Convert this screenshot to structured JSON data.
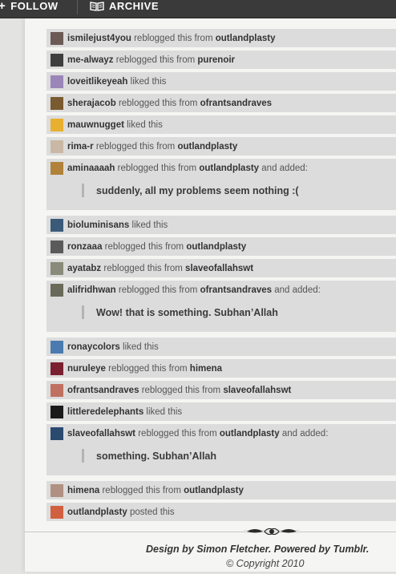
{
  "topbar": {
    "follow_label": "FOLLOW",
    "archive_label": "ARCHIVE"
  },
  "notes": [
    {
      "user": "ismilejust4you",
      "action": "reblogged this from",
      "source": "outlandplasty",
      "avatar_color": "#6b5a55"
    },
    {
      "user": "me-alwayz",
      "action": "reblogged this from",
      "source": "purenoir",
      "avatar_color": "#3e3e3e"
    },
    {
      "user": "loveitlikeyeah",
      "action": "liked this",
      "avatar_color": "#9a86b8"
    },
    {
      "user": "sherajacob",
      "action": "reblogged this from",
      "source": "ofrantsandraves",
      "avatar_color": "#7a5a30"
    },
    {
      "user": "mauwnugget",
      "action": "liked this",
      "avatar_color": "#e8b030"
    },
    {
      "user": "rima-r",
      "action": "reblogged this from",
      "source": "outlandplasty",
      "avatar_color": "#c9b8a4"
    },
    {
      "user": "aminaaaah",
      "action": "reblogged this from",
      "source": "outlandplasty",
      "added": "and added:",
      "quote": "suddenly, all my problems seem nothing :(",
      "avatar_color": "#b0823a"
    },
    {
      "user": "bioluminisans",
      "action": "liked this",
      "avatar_color": "#3a5a7a"
    },
    {
      "user": "ronzaaa",
      "action": "reblogged this from",
      "source": "outlandplasty",
      "avatar_color": "#5a5a5a"
    },
    {
      "user": "ayatabz",
      "action": "reblogged this from",
      "source": "slaveofallahswt",
      "avatar_color": "#8a8a7a"
    },
    {
      "user": "alifridhwan",
      "action": "reblogged this from",
      "source": "ofrantsandraves",
      "added": "and added:",
      "quote": "Wow! that is something. Subhan’Allah",
      "avatar_color": "#6a6a5a"
    },
    {
      "user": "ronaycolors",
      "action": "liked this",
      "avatar_color": "#4a7ab0"
    },
    {
      "user": "nuruleye",
      "action": "reblogged this from",
      "source": "himena",
      "avatar_color": "#7a2030"
    },
    {
      "user": "ofrantsandraves",
      "action": "reblogged this from",
      "source": "slaveofallahswt",
      "avatar_color": "#c07060"
    },
    {
      "user": "littleredelephants",
      "action": "liked this",
      "avatar_color": "#1a1a1a"
    },
    {
      "user": "slaveofallahswt",
      "action": "reblogged this from",
      "source": "outlandplasty",
      "added": "and added:",
      "quote": "something. Subhan’Allah",
      "avatar_color": "#2a4a70"
    },
    {
      "user": "himena",
      "action": "reblogged this from",
      "source": "outlandplasty",
      "avatar_color": "#b09080"
    },
    {
      "user": "outlandplasty",
      "action": "posted this",
      "avatar_color": "#d06040"
    }
  ],
  "footer": {
    "credit": "Design by Simon Fletcher. Powered by Tumblr.",
    "copyright": "© Copyright 2010"
  }
}
